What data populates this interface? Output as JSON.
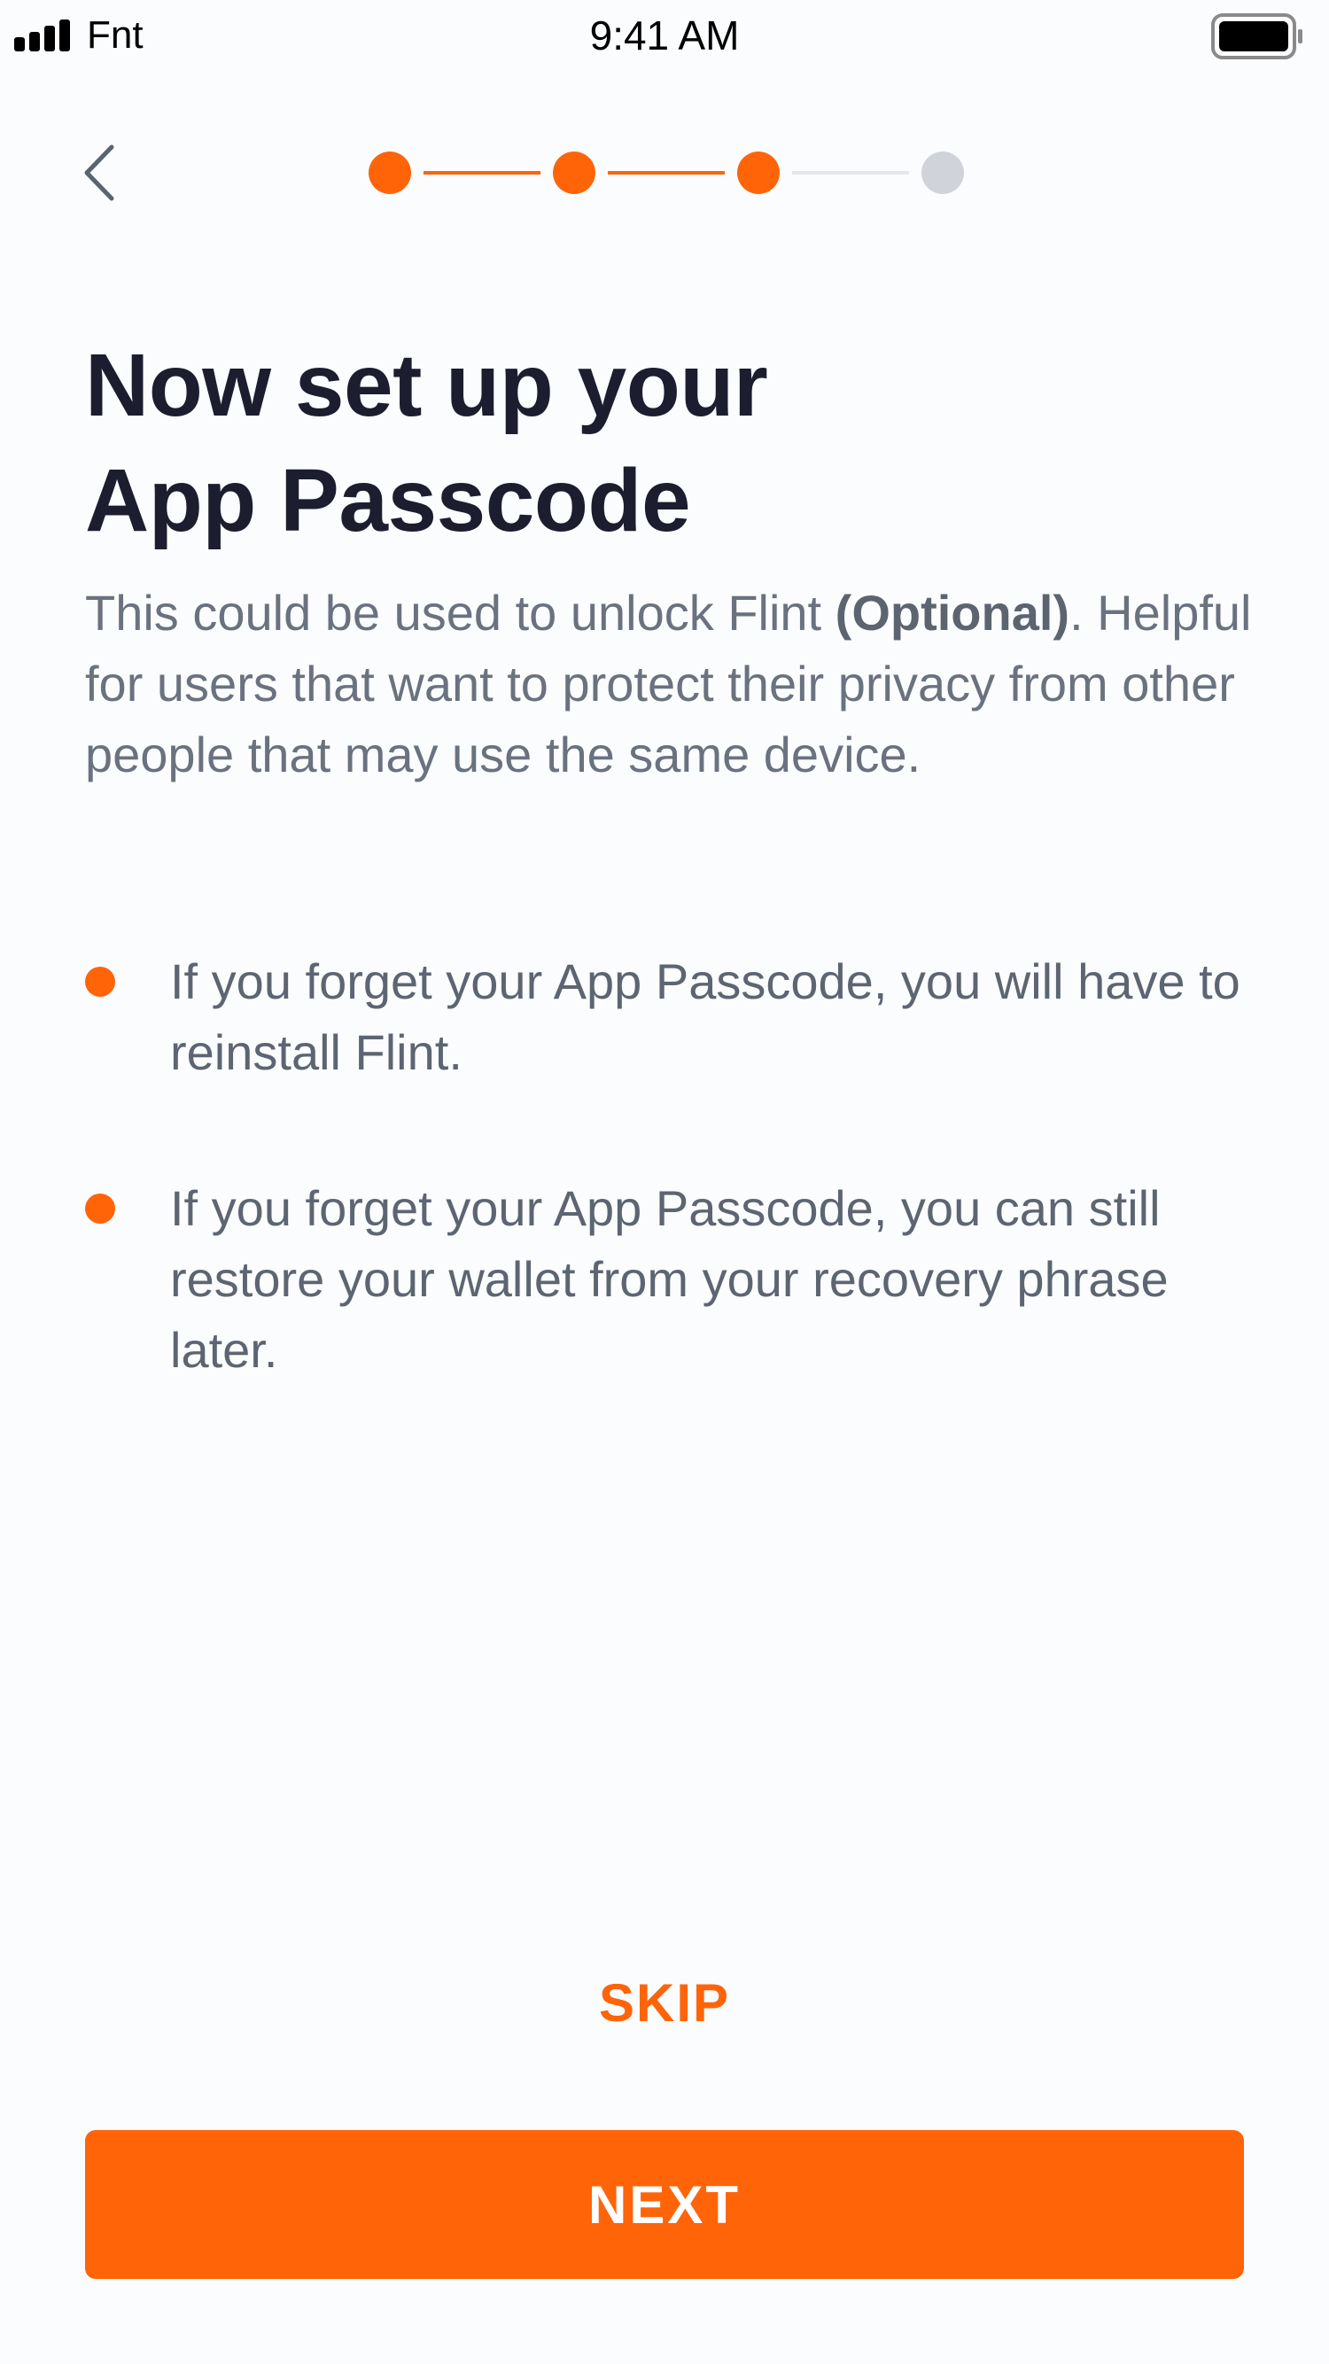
{
  "status_bar": {
    "carrier": "Fnt",
    "time": "9:41 AM",
    "signal_icon": "signal-bars-icon",
    "battery_icon": "battery-full-icon"
  },
  "nav": {
    "back_icon": "chevron-left-icon",
    "stepper": {
      "total_steps": 4,
      "completed_steps": 3
    }
  },
  "content": {
    "title_line1": "Now set up your",
    "title_line2": "App Passcode",
    "intro_before": "This could be used to unlock Flint ",
    "intro_bold": "(Optional)",
    "intro_after": ". Helpful for users that want to protect their privacy from other people that may use the same device.",
    "bullets": [
      {
        "text": "If you forget your App Passcode, you will have to reinstall Flint."
      },
      {
        "text": "If you forget your App Passcode, you can still restore your wallet from your recovery phrase later."
      }
    ]
  },
  "actions": {
    "skip_label": "SKIP",
    "next_label": "NEXT"
  },
  "colors": {
    "accent": "#ff6409",
    "inactive_step": "#d0d4da",
    "background": "#fbfcfe",
    "title_text": "#1c1d2e",
    "body_text": "#6a727f"
  }
}
